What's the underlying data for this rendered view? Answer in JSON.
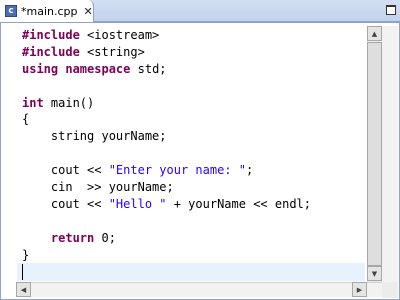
{
  "tab": {
    "title": "*main.cpp",
    "icon": "c-source-file-icon",
    "close_glyph": "✕",
    "icon_letter": "c"
  },
  "colors": {
    "keyword": "#7f0055",
    "string": "#2a00ff",
    "current_line": "#e8f2fe",
    "tab_bar": "#c2d2ec"
  },
  "code": {
    "lines": [
      [
        {
          "t": "#include",
          "k": "kw"
        },
        {
          "t": " <iostream>"
        }
      ],
      [
        {
          "t": "#include",
          "k": "kw"
        },
        {
          "t": " <string>"
        }
      ],
      [
        {
          "t": "using",
          "k": "kw"
        },
        {
          "t": " "
        },
        {
          "t": "namespace",
          "k": "kw"
        },
        {
          "t": " std;"
        }
      ],
      [
        {
          "t": ""
        }
      ],
      [
        {
          "t": "int",
          "k": "kw"
        },
        {
          "t": " main()"
        }
      ],
      [
        {
          "t": "{"
        }
      ],
      [
        {
          "t": "    string yourName;"
        }
      ],
      [
        {
          "t": ""
        }
      ],
      [
        {
          "t": "    cout << "
        },
        {
          "t": "\"Enter your name: \"",
          "k": "str"
        },
        {
          "t": ";"
        }
      ],
      [
        {
          "t": "    cin  >> yourName;"
        }
      ],
      [
        {
          "t": "    cout << "
        },
        {
          "t": "\"Hello \"",
          "k": "str"
        },
        {
          "t": " + yourName << endl;"
        }
      ],
      [
        {
          "t": ""
        }
      ],
      [
        {
          "t": "    "
        },
        {
          "t": "return",
          "k": "kw"
        },
        {
          "t": " 0;"
        }
      ],
      [
        {
          "t": "}"
        }
      ]
    ]
  }
}
